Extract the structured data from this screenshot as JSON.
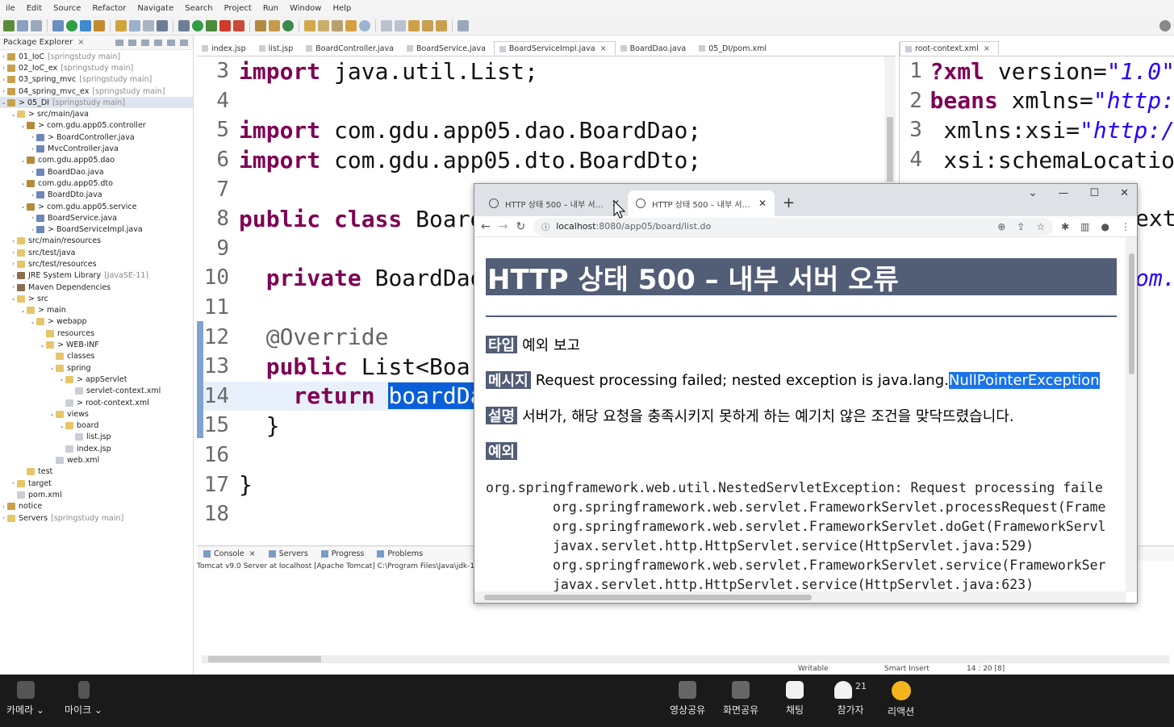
{
  "menu": [
    "ile",
    "Edit",
    "Source",
    "Refactor",
    "Navigate",
    "Search",
    "Project",
    "Run",
    "Window",
    "Help"
  ],
  "package_explorer": {
    "title": "Package Explorer",
    "items": [
      {
        "label": "01_IoC",
        "sub": "[springstudy main]",
        "depth": 0,
        "arrow": "›",
        "icon": "proj"
      },
      {
        "label": "02_IoC_ex",
        "sub": "[springstudy main]",
        "depth": 0,
        "arrow": "›",
        "icon": "proj"
      },
      {
        "label": "03_spring_mvc",
        "sub": "[springstudy main]",
        "depth": 0,
        "arrow": "›",
        "icon": "proj"
      },
      {
        "label": "04_spring_mvc_ex",
        "sub": "[springstudy main]",
        "depth": 0,
        "arrow": "›",
        "icon": "proj"
      },
      {
        "label": "> 05_DI",
        "sub": "[springstudy main]",
        "depth": 0,
        "arrow": "⌄",
        "icon": "proj",
        "selected": true
      },
      {
        "label": "> src/main/java",
        "sub": "",
        "depth": 1,
        "arrow": "⌄",
        "icon": "fold"
      },
      {
        "label": "> com.gdu.app05.controller",
        "sub": "",
        "depth": 2,
        "arrow": "⌄",
        "icon": "pkgi"
      },
      {
        "label": "> BoardController.java",
        "sub": "",
        "depth": 3,
        "arrow": "›",
        "icon": "java"
      },
      {
        "label": "MvcController.java",
        "sub": "",
        "depth": 3,
        "arrow": "›",
        "icon": "java"
      },
      {
        "label": "com.gdu.app05.dao",
        "sub": "",
        "depth": 2,
        "arrow": "⌄",
        "icon": "pkgi"
      },
      {
        "label": "BoardDao.java",
        "sub": "",
        "depth": 3,
        "arrow": "›",
        "icon": "java"
      },
      {
        "label": "com.gdu.app05.dto",
        "sub": "",
        "depth": 2,
        "arrow": "⌄",
        "icon": "pkgi"
      },
      {
        "label": "BoardDto.java",
        "sub": "",
        "depth": 3,
        "arrow": "›",
        "icon": "java"
      },
      {
        "label": "> com.gdu.app05.service",
        "sub": "",
        "depth": 2,
        "arrow": "⌄",
        "icon": "pkgi"
      },
      {
        "label": "BoardService.java",
        "sub": "",
        "depth": 3,
        "arrow": "›",
        "icon": "java"
      },
      {
        "label": "> BoardServiceImpl.java",
        "sub": "",
        "depth": 3,
        "arrow": "›",
        "icon": "java"
      },
      {
        "label": "src/main/resources",
        "sub": "",
        "depth": 1,
        "arrow": "›",
        "icon": "fold"
      },
      {
        "label": "src/test/java",
        "sub": "",
        "depth": 1,
        "arrow": "›",
        "icon": "fold"
      },
      {
        "label": "src/test/resources",
        "sub": "",
        "depth": 1,
        "arrow": "›",
        "icon": "fold"
      },
      {
        "label": "JRE System Library",
        "sub": "[JavaSE-11]",
        "depth": 1,
        "arrow": "›",
        "icon": "lib"
      },
      {
        "label": "Maven Dependencies",
        "sub": "",
        "depth": 1,
        "arrow": "›",
        "icon": "lib"
      },
      {
        "label": "> src",
        "sub": "",
        "depth": 1,
        "arrow": "⌄",
        "icon": "fold"
      },
      {
        "label": "> main",
        "sub": "",
        "depth": 2,
        "arrow": "⌄",
        "icon": "fold"
      },
      {
        "label": "> webapp",
        "sub": "",
        "depth": 3,
        "arrow": "⌄",
        "icon": "fold"
      },
      {
        "label": "resources",
        "sub": "",
        "depth": 4,
        "arrow": "",
        "icon": "fold"
      },
      {
        "label": "> WEB-INF",
        "sub": "",
        "depth": 4,
        "arrow": "⌄",
        "icon": "fold"
      },
      {
        "label": "classes",
        "sub": "",
        "depth": 5,
        "arrow": "",
        "icon": "fold"
      },
      {
        "label": "spring",
        "sub": "",
        "depth": 5,
        "arrow": "⌄",
        "icon": "fold"
      },
      {
        "label": "> appServlet",
        "sub": "",
        "depth": 6,
        "arrow": "⌄",
        "icon": "fold"
      },
      {
        "label": "servlet-context.xml",
        "sub": "",
        "depth": 7,
        "arrow": "",
        "icon": "file"
      },
      {
        "label": "> root-context.xml",
        "sub": "",
        "depth": 6,
        "arrow": "",
        "icon": "file"
      },
      {
        "label": "views",
        "sub": "",
        "depth": 5,
        "arrow": "⌄",
        "icon": "fold"
      },
      {
        "label": "board",
        "sub": "",
        "depth": 6,
        "arrow": "⌄",
        "icon": "fold"
      },
      {
        "label": "list.jsp",
        "sub": "",
        "depth": 7,
        "arrow": "",
        "icon": "file"
      },
      {
        "label": "index.jsp",
        "sub": "",
        "depth": 6,
        "arrow": "",
        "icon": "file"
      },
      {
        "label": "web.xml",
        "sub": "",
        "depth": 5,
        "arrow": "",
        "icon": "file"
      },
      {
        "label": "test",
        "sub": "",
        "depth": 2,
        "arrow": "",
        "icon": "fold"
      },
      {
        "label": "target",
        "sub": "",
        "depth": 1,
        "arrow": "›",
        "icon": "fold"
      },
      {
        "label": "pom.xml",
        "sub": "",
        "depth": 1,
        "arrow": "",
        "icon": "file"
      },
      {
        "label": "notice",
        "sub": "",
        "depth": 0,
        "arrow": "›",
        "icon": "proj"
      },
      {
        "label": "Servers",
        "sub": "[springstudy main]",
        "depth": 0,
        "arrow": "›",
        "icon": "fold"
      }
    ]
  },
  "editor_tabs": [
    "index.jsp",
    "list.jsp",
    "BoardController.java",
    "BoardService.java",
    "BoardServiceImpl.java",
    "BoardDao.java",
    "05_DI/pom.xml"
  ],
  "editor_active_tab": "BoardServiceImpl.java",
  "code_lines": [
    {
      "n": "3",
      "parts": [
        {
          "t": "import",
          "c": "kw"
        },
        {
          "t": " java.util.List;"
        }
      ]
    },
    {
      "n": "4",
      "parts": []
    },
    {
      "n": "5",
      "parts": [
        {
          "t": "import",
          "c": "kw"
        },
        {
          "t": " com.gdu.app05.dao.BoardDao;"
        }
      ]
    },
    {
      "n": "6",
      "parts": [
        {
          "t": "import",
          "c": "kw"
        },
        {
          "t": " com.gdu.app05.dto.BoardDto;"
        }
      ]
    },
    {
      "n": "7",
      "parts": []
    },
    {
      "n": "8",
      "parts": [
        {
          "t": "public class",
          "c": "kw"
        },
        {
          "t": " BoardS"
        }
      ]
    },
    {
      "n": "9",
      "parts": []
    },
    {
      "n": "10",
      "parts": [
        {
          "t": "  "
        },
        {
          "t": "private",
          "c": "kw"
        },
        {
          "t": " BoardDao"
        }
      ]
    },
    {
      "n": "11",
      "parts": []
    },
    {
      "n": "12",
      "parts": [
        {
          "t": "  "
        },
        {
          "t": "@Override",
          "c": "ann"
        }
      ]
    },
    {
      "n": "13",
      "parts": [
        {
          "t": "  "
        },
        {
          "t": "public",
          "c": "kw"
        },
        {
          "t": " List<Boar"
        }
      ]
    },
    {
      "n": "14",
      "parts": [
        {
          "t": "    "
        },
        {
          "t": "return",
          "c": "kw"
        },
        {
          "t": " "
        },
        {
          "t": "boardDao",
          "c": "hl"
        }
      ],
      "current": true
    },
    {
      "n": "15",
      "parts": [
        {
          "t": "  }"
        }
      ]
    },
    {
      "n": "16",
      "parts": []
    },
    {
      "n": "17",
      "parts": [
        {
          "t": "}"
        }
      ]
    },
    {
      "n": "18",
      "parts": []
    }
  ],
  "right_editor": {
    "tab": "root-context.xml",
    "lines": [
      {
        "n": "1",
        "parts": [
          {
            "t": "?xml",
            "c": "kw"
          },
          {
            "t": " version="
          },
          {
            "t": "\"1.0\"",
            "c": "str"
          }
        ]
      },
      {
        "n": "2",
        "parts": [
          {
            "t": "beans",
            "c": "kw"
          },
          {
            "t": " xmlns="
          },
          {
            "t": "\"http:",
            "c": "str"
          }
        ]
      },
      {
        "n": "3",
        "parts": [
          {
            "t": " xmlns:xsi="
          },
          {
            "t": "\"http:/",
            "c": "str"
          }
        ]
      },
      {
        "n": "4",
        "parts": [
          {
            "t": " xsi:schemaLocatio"
          }
        ]
      }
    ],
    "peek_1": "ext",
    "peek_2": "om."
  },
  "console": {
    "tabs": [
      "Console",
      "Servers",
      "Progress",
      "Problems"
    ],
    "line": "Tomcat v9.0 Server at localhost [Apache Tomcat] C:\\Program Files\\Java\\jdk-1"
  },
  "statusbar": {
    "mode": "Writable",
    "insert": "Smart Insert",
    "position": "14 : 20 [8]"
  },
  "browser": {
    "tabs": [
      "HTTP 상태 500 – 내부 서버 오류",
      "HTTP 상태 500 – 내부 서버 오류"
    ],
    "url_host": "localhost",
    "url_path": ":8080/app05/board/list.do",
    "heading": "HTTP 상태 500 – 내부 서버 오류",
    "type_label": "타입",
    "type_value": "예외 보고",
    "message_label": "메시지",
    "message_value": "Request processing failed; nested exception is java.lang.",
    "message_selected": "NullPointerException",
    "desc_label": "설명",
    "desc_value": "서버가, 해당 요청을 충족시키지 못하게 하는 예기치 않은 조건을 맞닥뜨렸습니다.",
    "exception_label": "예외",
    "trace": [
      "org.springframework.web.util.NestedServletException: Request processing faile",
      "\torg.springframework.web.servlet.FrameworkServlet.processRequest(Frame",
      "\torg.springframework.web.servlet.FrameworkServlet.doGet(FrameworkServl",
      "\tjavax.servlet.http.HttpServlet.service(HttpServlet.java:529)",
      "\torg.springframework.web.servlet.FrameworkServlet.service(FrameworkSer",
      "\tjavax.servlet.http.HttpServlet.service(HttpServlet.java:623)"
    ]
  },
  "meeting_bar": {
    "camera": "카메라 ⌄",
    "mic": "마이크 ⌄",
    "video_share": "영상공유",
    "screen_share": "화면공유",
    "chat": "채팅",
    "participants": "참가자",
    "participant_count": "21",
    "reaction": "리액션"
  }
}
